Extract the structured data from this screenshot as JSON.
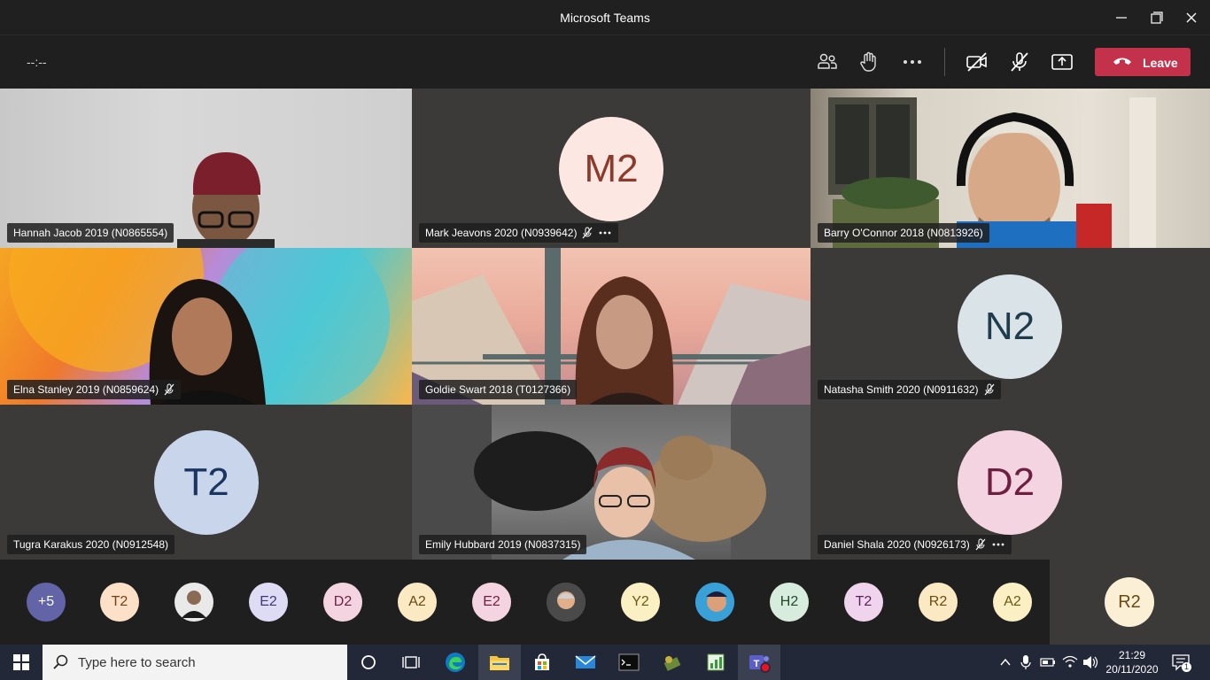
{
  "window": {
    "title": "Microsoft Teams"
  },
  "toolbar": {
    "timer": "--:--",
    "leave_label": "Leave",
    "icons": [
      "participants-icon",
      "raise-hand-icon",
      "more-icon",
      "camera-off-icon",
      "mic-off-icon",
      "share-screen-icon"
    ]
  },
  "participants": [
    {
      "name": "Hannah Jacob 2019 (N0865554)",
      "video": true,
      "muted": false,
      "more": false
    },
    {
      "name": "Mark Jeavons 2020 (N0939642)",
      "initials": "M2",
      "video": false,
      "muted": true,
      "more": true
    },
    {
      "name": "Barry O'Connor 2018 (N0813926)",
      "video": true,
      "muted": false,
      "more": false
    },
    {
      "name": "Elna Stanley 2019 (N0859624)",
      "video": true,
      "muted": true,
      "more": false
    },
    {
      "name": "Goldie Swart 2018 (T0127366)",
      "video": true,
      "muted": false,
      "more": false
    },
    {
      "name": "Natasha Smith 2020 (N0911632)",
      "initials": "N2",
      "video": false,
      "muted": true,
      "more": false
    },
    {
      "name": "Tugra Karakus 2020 (N0912548)",
      "initials": "T2",
      "video": false,
      "muted": false,
      "more": false
    },
    {
      "name": "Emily Hubbard 2019 (N0837315)",
      "video": true,
      "muted": false,
      "more": false
    },
    {
      "name": "Daniel Shala 2020 (N0926173)",
      "initials": "D2",
      "video": false,
      "muted": true,
      "more": true
    }
  ],
  "strip": {
    "overflow": "+5",
    "avatars": [
      "T2",
      "",
      "E2",
      "D2",
      "A2",
      "E2",
      "",
      "Y2",
      "",
      "H2",
      "T2",
      "R2",
      "A2"
    ],
    "self": "R2"
  },
  "taskbar": {
    "search_placeholder": "Type here to search",
    "time": "21:29",
    "date": "20/11/2020",
    "notifications": "1"
  },
  "colors": {
    "accent_leave": "#c4314b",
    "avatar_M2_bg": "#fde7e3",
    "avatar_M2_fg": "#8c3a2a",
    "avatar_N2_bg": "#dae3e8",
    "avatar_N2_fg": "#1e3c4b",
    "avatar_T2_bg": "#c9d5ea",
    "avatar_T2_fg": "#1b3563",
    "avatar_D2_bg": "#f4d4e1",
    "avatar_D2_fg": "#6e1e40"
  }
}
